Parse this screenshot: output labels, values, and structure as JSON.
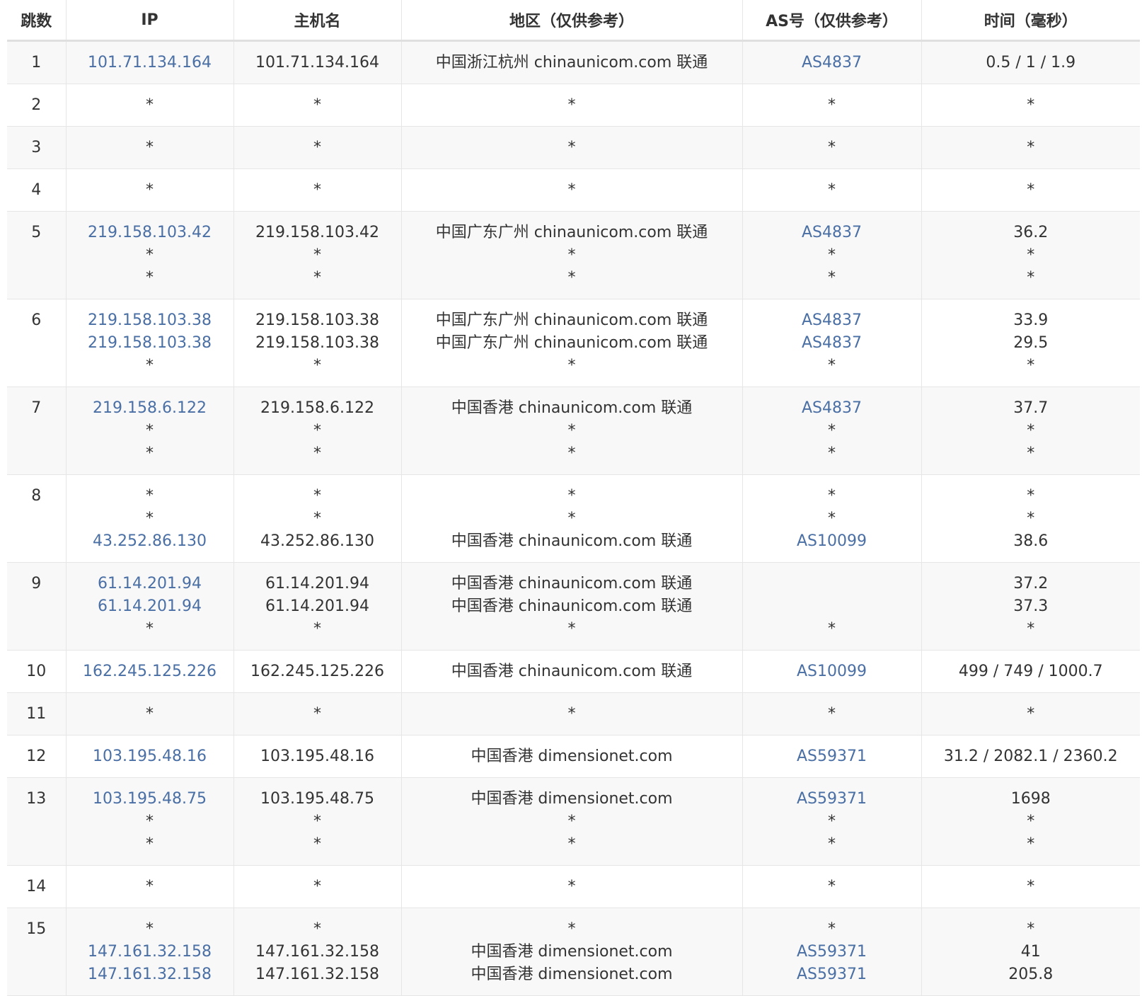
{
  "headers": [
    "跳数",
    "IP",
    "主机名",
    "地区（仅供参考）",
    "AS号（仅供参考）",
    "时间（毫秒）"
  ],
  "rows": [
    {
      "hop": "1",
      "ip": [
        "101.71.134.164"
      ],
      "host": [
        "101.71.134.164"
      ],
      "region": [
        "中国浙江杭州 chinaunicom.com 联通"
      ],
      "as": [
        "AS4837"
      ],
      "time": [
        "0.5 / 1 / 1.9"
      ]
    },
    {
      "hop": "2",
      "ip": [
        "*"
      ],
      "host": [
        "*"
      ],
      "region": [
        "*"
      ],
      "as": [
        "*"
      ],
      "time": [
        "*"
      ]
    },
    {
      "hop": "3",
      "ip": [
        "*"
      ],
      "host": [
        "*"
      ],
      "region": [
        "*"
      ],
      "as": [
        "*"
      ],
      "time": [
        "*"
      ]
    },
    {
      "hop": "4",
      "ip": [
        "*"
      ],
      "host": [
        "*"
      ],
      "region": [
        "*"
      ],
      "as": [
        "*"
      ],
      "time": [
        "*"
      ]
    },
    {
      "hop": "5",
      "ip": [
        "219.158.103.42",
        "*",
        "*"
      ],
      "host": [
        "219.158.103.42",
        "*",
        "*"
      ],
      "region": [
        "中国广东广州 chinaunicom.com 联通",
        "*",
        "*"
      ],
      "as": [
        "AS4837",
        "*",
        "*"
      ],
      "time": [
        "36.2",
        "*",
        "*"
      ]
    },
    {
      "hop": "6",
      "ip": [
        "219.158.103.38",
        "219.158.103.38",
        "*"
      ],
      "host": [
        "219.158.103.38",
        "219.158.103.38",
        "*"
      ],
      "region": [
        "中国广东广州 chinaunicom.com 联通",
        "中国广东广州 chinaunicom.com 联通",
        "*"
      ],
      "as": [
        "AS4837",
        "AS4837",
        "*"
      ],
      "time": [
        "33.9",
        "29.5",
        "*"
      ]
    },
    {
      "hop": "7",
      "ip": [
        "219.158.6.122",
        "*",
        "*"
      ],
      "host": [
        "219.158.6.122",
        "*",
        "*"
      ],
      "region": [
        "中国香港 chinaunicom.com 联通",
        "*",
        "*"
      ],
      "as": [
        "AS4837",
        "*",
        "*"
      ],
      "time": [
        "37.7",
        "*",
        "*"
      ]
    },
    {
      "hop": "8",
      "ip": [
        "*",
        "*",
        "43.252.86.130"
      ],
      "host": [
        "*",
        "*",
        "43.252.86.130"
      ],
      "region": [
        "*",
        "*",
        "中国香港 chinaunicom.com 联通"
      ],
      "as": [
        "*",
        "*",
        "AS10099"
      ],
      "time": [
        "*",
        "*",
        "38.6"
      ]
    },
    {
      "hop": "9",
      "ip": [
        "61.14.201.94",
        "61.14.201.94",
        "*"
      ],
      "host": [
        "61.14.201.94",
        "61.14.201.94",
        "*"
      ],
      "region": [
        "中国香港 chinaunicom.com 联通",
        "中国香港 chinaunicom.com 联通",
        "*"
      ],
      "as": [
        "",
        "",
        "*"
      ],
      "time": [
        "37.2",
        "37.3",
        "*"
      ]
    },
    {
      "hop": "10",
      "ip": [
        "162.245.125.226"
      ],
      "host": [
        "162.245.125.226"
      ],
      "region": [
        "中国香港 chinaunicom.com 联通"
      ],
      "as": [
        "AS10099"
      ],
      "time": [
        "499 / 749 / 1000.7"
      ]
    },
    {
      "hop": "11",
      "ip": [
        "*"
      ],
      "host": [
        "*"
      ],
      "region": [
        "*"
      ],
      "as": [
        "*"
      ],
      "time": [
        "*"
      ]
    },
    {
      "hop": "12",
      "ip": [
        "103.195.48.16"
      ],
      "host": [
        "103.195.48.16"
      ],
      "region": [
        "中国香港 dimensionet.com"
      ],
      "as": [
        "AS59371"
      ],
      "time": [
        "31.2 / 2082.1 / 2360.2"
      ]
    },
    {
      "hop": "13",
      "ip": [
        "103.195.48.75",
        "*",
        "*"
      ],
      "host": [
        "103.195.48.75",
        "*",
        "*"
      ],
      "region": [
        "中国香港 dimensionet.com",
        "*",
        "*"
      ],
      "as": [
        "AS59371",
        "*",
        "*"
      ],
      "time": [
        "1698",
        "*",
        "*"
      ]
    },
    {
      "hop": "14",
      "ip": [
        "*"
      ],
      "host": [
        "*"
      ],
      "region": [
        "*"
      ],
      "as": [
        "*"
      ],
      "time": [
        "*"
      ]
    },
    {
      "hop": "15",
      "ip": [
        "*",
        "147.161.32.158",
        "147.161.32.158"
      ],
      "host": [
        "*",
        "147.161.32.158",
        "147.161.32.158"
      ],
      "region": [
        "*",
        "中国香港 dimensionet.com",
        "中国香港 dimensionet.com"
      ],
      "as": [
        "*",
        "AS59371",
        "AS59371"
      ],
      "time": [
        "*",
        "41",
        "205.8"
      ]
    }
  ],
  "colors": {
    "link": "#4a6fa5",
    "text": "#333333",
    "stripe": "#f8f8f8",
    "border": "#e6e6e6"
  }
}
